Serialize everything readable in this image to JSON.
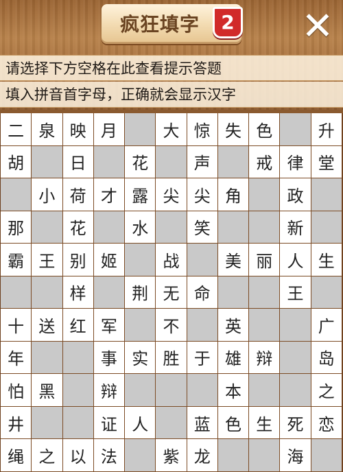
{
  "header": {
    "title": "疯狂填字",
    "level_badge": "2",
    "close_label": "✕"
  },
  "hints": [
    "请选择下方空格在此查看提示答题",
    "填入拼音首字母，正确就会显示汉字"
  ],
  "grid": {
    "rows": 11,
    "cols": 11,
    "cells": [
      [
        "二",
        "泉",
        "映",
        "月",
        null,
        "大",
        "惊",
        "失",
        "色",
        null,
        "升"
      ],
      [
        "胡",
        "",
        "日",
        "",
        "花",
        "",
        "声",
        "",
        "戒",
        "律",
        "堂"
      ],
      [
        "",
        "小",
        "荷",
        "才",
        "露",
        "尖",
        "尖",
        "角",
        "",
        "政",
        ""
      ],
      [
        "那",
        "",
        "花",
        "",
        "水",
        "",
        "笑",
        "",
        "",
        "新",
        ""
      ],
      [
        "霸",
        "王",
        "别",
        "姬",
        "",
        "战",
        "",
        "美",
        "丽",
        "人",
        "生"
      ],
      [
        "",
        "",
        "样",
        "",
        "荆",
        "无",
        "命",
        "",
        "",
        "王",
        ""
      ],
      [
        "十",
        "送",
        "红",
        "军",
        "",
        "不",
        "",
        "英",
        "",
        "",
        "广"
      ],
      [
        "年",
        "",
        "",
        "事",
        "实",
        "胜",
        "于",
        "雄",
        "辩",
        "",
        "岛"
      ],
      [
        "怕",
        "黑",
        "",
        "辩",
        "",
        "",
        "",
        "本",
        "",
        "",
        "之"
      ],
      [
        "井",
        "",
        "",
        "证",
        "人",
        "",
        "蓝",
        "色",
        "生",
        "死",
        "恋"
      ],
      [
        "绳",
        "之",
        "以",
        "法",
        "",
        "紫",
        "龙",
        "",
        "",
        "海",
        ""
      ]
    ],
    "gray_mask": [
      [
        0,
        0,
        0,
        0,
        1,
        0,
        0,
        0,
        0,
        1,
        0
      ],
      [
        0,
        1,
        0,
        1,
        0,
        1,
        0,
        1,
        0,
        0,
        0
      ],
      [
        1,
        0,
        0,
        0,
        0,
        0,
        0,
        0,
        1,
        0,
        1
      ],
      [
        0,
        1,
        0,
        1,
        0,
        1,
        0,
        1,
        1,
        0,
        1
      ],
      [
        0,
        0,
        0,
        0,
        1,
        0,
        1,
        0,
        0,
        0,
        0
      ],
      [
        1,
        1,
        0,
        1,
        0,
        0,
        0,
        1,
        1,
        0,
        1
      ],
      [
        0,
        0,
        0,
        0,
        1,
        0,
        1,
        0,
        1,
        1,
        0
      ],
      [
        0,
        1,
        1,
        0,
        0,
        0,
        0,
        0,
        0,
        1,
        0
      ],
      [
        0,
        0,
        1,
        0,
        1,
        1,
        1,
        0,
        1,
        1,
        0
      ],
      [
        0,
        1,
        1,
        0,
        0,
        1,
        0,
        0,
        0,
        0,
        0
      ],
      [
        0,
        0,
        0,
        0,
        1,
        0,
        0,
        1,
        1,
        0,
        1
      ]
    ]
  }
}
